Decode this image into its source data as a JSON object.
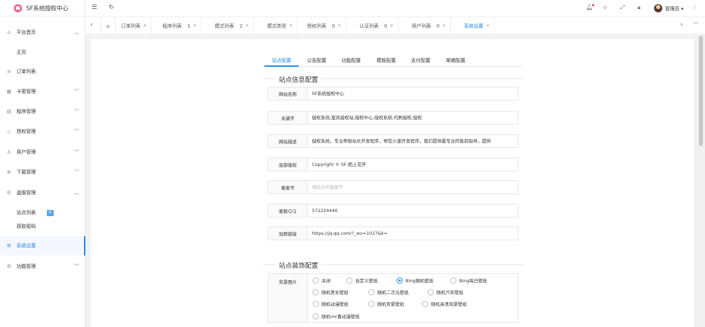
{
  "app": {
    "title": "SF系统授权中心"
  },
  "sidebar": {
    "items": [
      {
        "label": "平台首页",
        "icon": "home-icon",
        "expanded": true
      },
      {
        "label": "主页"
      },
      {
        "label": "订单列表",
        "icon": "list-icon"
      },
      {
        "label": "卡密管理",
        "icon": "card-icon"
      },
      {
        "label": "程序管理",
        "icon": "app-icon"
      },
      {
        "label": "授权管理",
        "icon": "shield-icon"
      },
      {
        "label": "用户管理",
        "icon": "user-icon"
      },
      {
        "label": "下载管理",
        "icon": "download-icon"
      },
      {
        "label": "盗版管理",
        "icon": "gear-icon",
        "expanded": true
      },
      {
        "label": "站点列表",
        "badge": "0"
      },
      {
        "label": "获取密码"
      },
      {
        "label": "系统设置",
        "icon": "gear-icon",
        "active": true
      },
      {
        "label": "功能管理",
        "icon": "gear-icon"
      }
    ]
  },
  "header": {
    "user": "管理员"
  },
  "tabs": [
    {
      "label": "订单列表"
    },
    {
      "label": "程序列表",
      "count": "1"
    },
    {
      "label": "模式列表",
      "count": "2"
    },
    {
      "label": "模式类型"
    },
    {
      "label": "授权列表",
      "count": "0"
    },
    {
      "label": "认证列表",
      "count": "0"
    },
    {
      "label": "用户列表",
      "count": "0"
    },
    {
      "label": "系统设置",
      "active": true
    }
  ],
  "settings": {
    "tabs": [
      "站点配置",
      "公告配置",
      "功能配置",
      "模板配置",
      "支付配置",
      "邮箱配置"
    ],
    "active_tab": "站点配置",
    "site_info": {
      "legend": "站点信息配置",
      "fields": [
        {
          "label": "网站名称",
          "value": "SF系统授权中心",
          "placeholder": ""
        },
        {
          "label": "关键字",
          "value": "授权系统,旋风授权站,授权中心,授权系统,代刷授权,授权",
          "placeholder": ""
        },
        {
          "label": "网站描述",
          "value": "授权系统，专业帮助站长开发程序，帮您火速开发程序，我们提供最专业的售前指导，提供",
          "placeholder": ""
        },
        {
          "label": "底部版权",
          "value": "Copyright © SF-陌上花开",
          "placeholder": ""
        },
        {
          "label": "备案号",
          "value": "",
          "placeholder": "填站点的备案号"
        },
        {
          "label": "客服ＱＱ",
          "value": "572224446",
          "placeholder": ""
        },
        {
          "label": "加群链接",
          "value": "https://jq.qq.com/?_wv=1027&k=",
          "placeholder": ""
        }
      ]
    },
    "site_decor": {
      "legend": "站点装饰配置",
      "bg_label": "背景图片",
      "options": [
        "关闭",
        "自定义壁纸",
        "Bing随机壁纸",
        "Bing每日壁纸",
        "随机美女壁纸",
        "随机二次元壁纸",
        "随机汽车壁纸",
        "随机动漫壁纸",
        "随机背景壁纸",
        "随机高清风景壁纸",
        "随机mc喜动漫壁纸"
      ],
      "selected": "Bing随机壁纸"
    }
  }
}
